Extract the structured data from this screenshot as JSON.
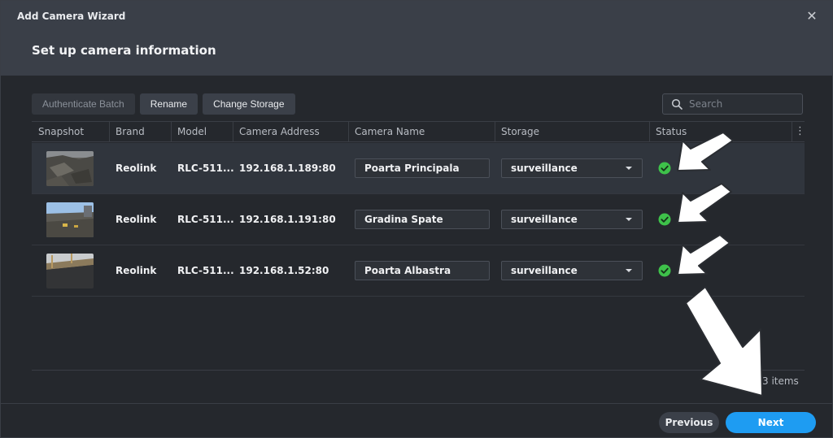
{
  "window": {
    "title": "Add Camera Wizard",
    "close_glyph": "✕"
  },
  "step_title": "Set up camera information",
  "toolbar": {
    "authenticate_batch": "Authenticate Batch",
    "rename": "Rename",
    "change_storage": "Change Storage"
  },
  "search": {
    "placeholder": "Search"
  },
  "columns": [
    "Snapshot",
    "Brand",
    "Model",
    "Camera Address",
    "Camera Name",
    "Storage",
    "Status"
  ],
  "rows": [
    {
      "brand": "Reolink",
      "model": "RLC-511...",
      "address": "192.168.1.189:80",
      "name": "Poarta Principala",
      "storage": "surveillance",
      "status": "ok"
    },
    {
      "brand": "Reolink",
      "model": "RLC-511...",
      "address": "192.168.1.191:80",
      "name": "Gradina Spate",
      "storage": "surveillance",
      "status": "ok"
    },
    {
      "brand": "Reolink",
      "model": "RLC-511...",
      "address": "192.168.1.52:80",
      "name": "Poarta Albastra",
      "storage": "surveillance",
      "status": "ok"
    }
  ],
  "item_count": "3 items",
  "footer": {
    "previous": "Previous",
    "next": "Next"
  },
  "colors": {
    "accent": "#1e9cf2",
    "status_ok": "#3ec14a"
  },
  "icons": {
    "search": "search-icon",
    "more": "more-vertical-icon",
    "status": "check-circle-icon",
    "close": "close-icon"
  }
}
